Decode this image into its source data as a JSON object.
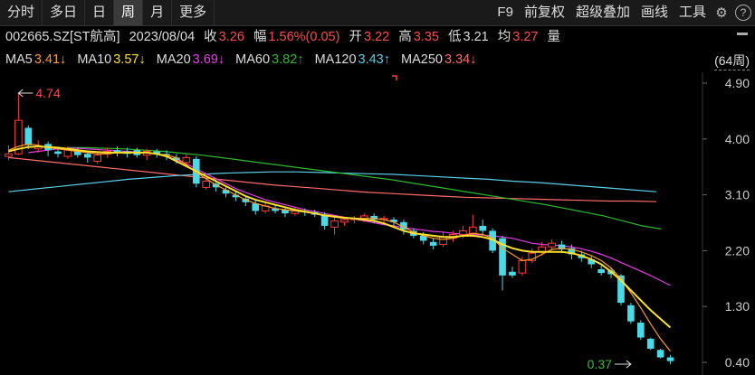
{
  "tabs": [
    {
      "label": "分时",
      "active": false
    },
    {
      "label": "多日",
      "active": false
    },
    {
      "label": "日",
      "active": false
    },
    {
      "label": "周",
      "active": true
    },
    {
      "label": "月",
      "active": false
    },
    {
      "label": "更多",
      "active": false
    }
  ],
  "tools": [
    "F9",
    "前复权",
    "超级叠加",
    "画线",
    "工具"
  ],
  "stock": {
    "code": "002665.SZ[ST航高]",
    "date": "2023/08/04",
    "close_label": "收",
    "close": "3.26",
    "change_label": "幅",
    "change": "1.56%(0.05)",
    "open_label": "开",
    "open": "3.22",
    "high_label": "高",
    "high": "3.35",
    "low_label": "低",
    "low": "3.21",
    "avg_label": "均",
    "avg": "3.27",
    "vol_label": "量"
  },
  "ma_legend": [
    {
      "label": "MA5",
      "value": "3.41↓",
      "color": "#ff9a2e"
    },
    {
      "label": "MA10",
      "value": "3.57↓",
      "color": "#ffe02a"
    },
    {
      "label": "MA20",
      "value": "3.69↓",
      "color": "#e83be8"
    },
    {
      "label": "MA60",
      "value": "3.82↑",
      "color": "#2fb82f"
    },
    {
      "label": "MA120",
      "value": "3.43↑",
      "color": "#59cfe6"
    },
    {
      "label": "MA250",
      "value": "3.34↓",
      "color": "#ff6a6a"
    }
  ],
  "period": "(64周)",
  "chart_data": {
    "type": "candlestick",
    "ylim": [
      0.4,
      4.9
    ],
    "y_ticks": [
      "4.90",
      "4.00",
      "3.10",
      "2.20",
      "1.30",
      "0.40"
    ],
    "annotations": [
      {
        "text": "4.74",
        "value": 4.74,
        "index": 1
      },
      {
        "text": "0.37",
        "value": 0.37,
        "index": 63
      }
    ],
    "colors": {
      "up": "#ff3b3b",
      "down": "#4ad9e6",
      "ma5": "#ff9a2e",
      "ma10": "#ffe02a",
      "ma20": "#e83be8",
      "ma60": "#2fb82f",
      "ma120": "#59cfe6",
      "ma250": "#ff6a6a"
    },
    "candles": [
      [
        3.72,
        3.76,
        3.9,
        3.66
      ],
      [
        3.76,
        4.3,
        4.74,
        3.74
      ],
      [
        4.18,
        3.9,
        4.22,
        3.84
      ],
      [
        3.84,
        3.88,
        3.98,
        3.78
      ],
      [
        3.92,
        3.82,
        3.96,
        3.72
      ],
      [
        3.8,
        3.76,
        3.85,
        3.7
      ],
      [
        3.72,
        3.82,
        3.88,
        3.68
      ],
      [
        3.82,
        3.74,
        3.86,
        3.7
      ],
      [
        3.76,
        3.7,
        3.8,
        3.62
      ],
      [
        3.64,
        3.74,
        3.8,
        3.6
      ],
      [
        3.76,
        3.8,
        3.86,
        3.7
      ],
      [
        3.82,
        3.78,
        3.88,
        3.72
      ],
      [
        3.8,
        3.76,
        3.86,
        3.7
      ],
      [
        3.82,
        3.74,
        3.86,
        3.7
      ],
      [
        3.74,
        3.8,
        3.84,
        3.66
      ],
      [
        3.8,
        3.76,
        3.84,
        3.7
      ],
      [
        3.76,
        3.74,
        3.82,
        3.66
      ],
      [
        3.7,
        3.66,
        3.76,
        3.6
      ],
      [
        3.62,
        3.7,
        3.76,
        3.58
      ],
      [
        3.68,
        3.28,
        3.72,
        3.22
      ],
      [
        3.22,
        3.32,
        3.38,
        3.18
      ],
      [
        3.28,
        3.22,
        3.34,
        3.15
      ],
      [
        3.18,
        3.12,
        3.22,
        3.06
      ],
      [
        3.1,
        3.06,
        3.16,
        3.0
      ],
      [
        3.04,
        2.98,
        3.08,
        2.92
      ],
      [
        2.96,
        2.84,
        3.02,
        2.78
      ],
      [
        2.84,
        2.92,
        2.98,
        2.8
      ],
      [
        2.88,
        2.84,
        2.94,
        2.8
      ],
      [
        2.86,
        2.8,
        2.9,
        2.74
      ],
      [
        2.8,
        2.86,
        2.9,
        2.76
      ],
      [
        2.84,
        2.82,
        2.88,
        2.76
      ],
      [
        2.82,
        2.78,
        2.86,
        2.74
      ],
      [
        2.78,
        2.6,
        2.82,
        2.54
      ],
      [
        2.58,
        2.68,
        2.74,
        2.46
      ],
      [
        2.66,
        2.7,
        2.74,
        2.6
      ],
      [
        2.7,
        2.72,
        2.76,
        2.64
      ],
      [
        2.72,
        2.76,
        2.8,
        2.66
      ],
      [
        2.76,
        2.7,
        2.8,
        2.64
      ],
      [
        2.7,
        2.72,
        2.76,
        2.64
      ],
      [
        2.7,
        2.66,
        2.74,
        2.6
      ],
      [
        2.66,
        2.54,
        2.7,
        2.46
      ],
      [
        2.52,
        2.44,
        2.56,
        2.4
      ],
      [
        2.44,
        2.36,
        2.5,
        2.3
      ],
      [
        2.34,
        2.28,
        2.4,
        2.22
      ],
      [
        2.3,
        2.42,
        2.5,
        2.26
      ],
      [
        2.4,
        2.46,
        2.52,
        2.34
      ],
      [
        2.46,
        2.52,
        2.6,
        2.4
      ],
      [
        2.48,
        2.58,
        2.78,
        2.42
      ],
      [
        2.6,
        2.52,
        2.7,
        2.46
      ],
      [
        2.52,
        2.2,
        2.56,
        2.16
      ],
      [
        2.4,
        1.8,
        2.44,
        1.56
      ],
      [
        1.86,
        1.8,
        1.94,
        1.76
      ],
      [
        1.84,
        2.04,
        2.1,
        1.8
      ],
      [
        2.04,
        2.16,
        2.24,
        2.0
      ],
      [
        2.18,
        2.26,
        2.34,
        2.12
      ],
      [
        2.26,
        2.32,
        2.38,
        2.2
      ],
      [
        2.3,
        2.22,
        2.36,
        2.16
      ],
      [
        2.24,
        2.14,
        2.3,
        2.06
      ],
      [
        2.14,
        2.08,
        2.2,
        2.02
      ],
      [
        2.06,
        1.98,
        2.12,
        1.92
      ],
      [
        1.9,
        1.84,
        1.96,
        1.8
      ],
      [
        1.88,
        1.82,
        1.92,
        1.76
      ],
      [
        1.8,
        1.36,
        1.82,
        1.32
      ],
      [
        1.32,
        1.06,
        1.36,
        1.02
      ],
      [
        1.04,
        0.8,
        1.08,
        0.76
      ],
      [
        0.78,
        0.62,
        0.8,
        0.6
      ],
      [
        0.6,
        0.48,
        0.62,
        0.46
      ],
      [
        0.48,
        0.42,
        0.52,
        0.37
      ]
    ],
    "ma5": [
      3.82,
      3.88,
      3.92,
      3.9,
      3.86,
      3.84,
      3.82,
      3.8,
      3.78,
      3.76,
      3.76,
      3.78,
      3.78,
      3.78,
      3.78,
      3.76,
      3.74,
      3.7,
      3.58,
      3.46,
      3.36,
      3.26,
      3.18,
      3.1,
      3.02,
      2.96,
      2.92,
      2.88,
      2.86,
      2.84,
      2.82,
      2.8,
      2.76,
      2.74,
      2.72,
      2.72,
      2.72,
      2.72,
      2.7,
      2.66,
      2.58,
      2.5,
      2.44,
      2.4,
      2.38,
      2.4,
      2.44,
      2.48,
      2.46,
      2.4,
      2.24,
      2.14,
      2.04,
      2.06,
      2.14,
      2.22,
      2.24,
      2.22,
      2.18,
      2.12,
      2.04,
      1.92,
      1.74,
      1.52,
      1.28,
      1.02,
      0.78,
      0.58
    ],
    "ma10": [
      3.8,
      3.84,
      3.87,
      3.88,
      3.87,
      3.86,
      3.84,
      3.82,
      3.8,
      3.79,
      3.78,
      3.78,
      3.78,
      3.78,
      3.78,
      3.76,
      3.72,
      3.64,
      3.56,
      3.48,
      3.4,
      3.32,
      3.24,
      3.16,
      3.08,
      3.02,
      2.98,
      2.94,
      2.9,
      2.86,
      2.83,
      2.8,
      2.77,
      2.75,
      2.73,
      2.72,
      2.7,
      2.68,
      2.64,
      2.58,
      2.52,
      2.48,
      2.46,
      2.44,
      2.42,
      2.42,
      2.44,
      2.44,
      2.42,
      2.38,
      2.3,
      2.24,
      2.2,
      2.18,
      2.18,
      2.18,
      2.18,
      2.16,
      2.12,
      2.06,
      1.98,
      1.86,
      1.72,
      1.56,
      1.4,
      1.24,
      1.1,
      0.96
    ],
    "ma20": [
      3.78,
      3.8,
      3.82,
      3.84,
      3.85,
      3.85,
      3.84,
      3.83,
      3.82,
      3.81,
      3.8,
      3.79,
      3.78,
      3.76,
      3.72,
      3.66,
      3.6,
      3.52,
      3.44,
      3.36,
      3.28,
      3.2,
      3.14,
      3.08,
      3.02,
      2.98,
      2.94,
      2.9,
      2.86,
      2.83,
      2.8,
      2.77,
      2.74,
      2.71,
      2.68,
      2.65,
      2.62,
      2.6,
      2.57,
      2.55,
      2.53,
      2.51,
      2.5,
      2.48,
      2.47,
      2.46,
      2.45,
      2.44,
      2.42,
      2.4,
      2.36,
      2.32,
      2.3,
      2.29,
      2.28,
      2.26,
      2.23,
      2.19,
      2.14,
      2.08,
      2.01,
      1.94,
      1.87,
      1.8,
      1.72,
      1.64
    ],
    "ma20_start": 2,
    "ma60": [
      3.86,
      3.86,
      3.85,
      3.84,
      3.82,
      3.8,
      3.77,
      3.74,
      3.7,
      3.66,
      3.62,
      3.58,
      3.54,
      3.5,
      3.46,
      3.42,
      3.38,
      3.34,
      3.29,
      3.24,
      3.19,
      3.14,
      3.09,
      3.04,
      2.99,
      2.94,
      2.88,
      2.82,
      2.76,
      2.68,
      2.6,
      2.55
    ],
    "ma60_start": 6,
    "ma120": [
      3.15,
      3.19,
      3.23,
      3.27,
      3.31,
      3.35,
      3.38,
      3.41,
      3.43,
      3.45,
      3.46,
      3.47,
      3.47,
      3.46,
      3.45,
      3.44,
      3.43,
      3.41,
      3.39,
      3.37,
      3.35,
      3.32,
      3.3,
      3.27,
      3.24,
      3.21,
      3.18,
      3.15
    ],
    "ma120_start": 0,
    "ma250": [
      3.7,
      3.66,
      3.62,
      3.58,
      3.54,
      3.5,
      3.46,
      3.42,
      3.38,
      3.34,
      3.3,
      3.26,
      3.23,
      3.2,
      3.17,
      3.14,
      3.12,
      3.1,
      3.08,
      3.06,
      3.05,
      3.04,
      3.03,
      3.02,
      3.01,
      3.0,
      3.0,
      2.99
    ],
    "ma250_start": 0
  }
}
